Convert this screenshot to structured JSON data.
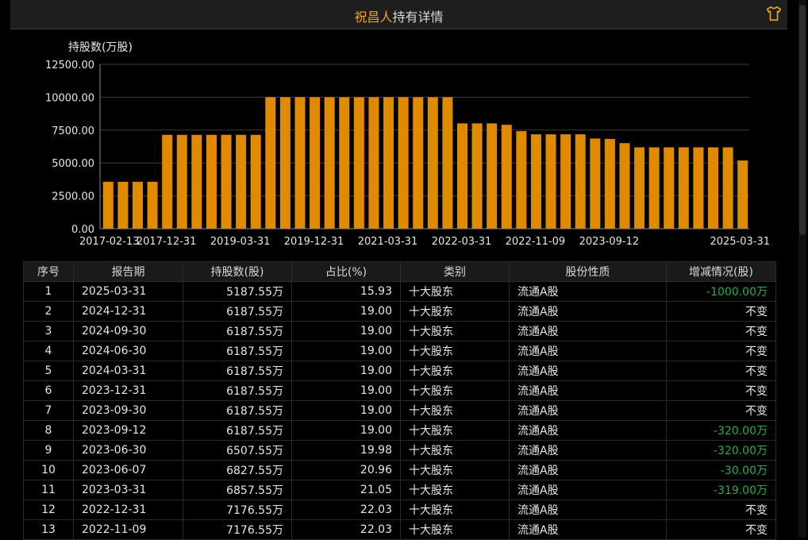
{
  "title": {
    "name": "祝昌人",
    "rest": "持有详情"
  },
  "chart_data": {
    "type": "bar",
    "ylabel": "持股数(万股)",
    "ylim": [
      0,
      12500
    ],
    "yticks": [
      "12500.00",
      "10000.00",
      "7500.00",
      "5000.00",
      "2500.00",
      "0.00"
    ],
    "xtick_labels": [
      "2017-02-13",
      "2017-12-31",
      "2019-03-31",
      "2019-12-31",
      "2021-03-31",
      "2022-03-31",
      "2022-11-09",
      "2023-09-12",
      "2025-03-31"
    ],
    "bar_color": "#e08a00",
    "values": [
      3570,
      3570,
      3570,
      3570,
      7140,
      7140,
      7140,
      7140,
      7140,
      7140,
      7140,
      10000,
      10000,
      10000,
      10000,
      10000,
      10000,
      10000,
      10000,
      10000,
      10000,
      10000,
      10000,
      10000,
      8010,
      8010,
      8010,
      7900,
      7420,
      7176.55,
      7176.55,
      7176.55,
      7176.55,
      6857.55,
      6827.55,
      6507.55,
      6187.55,
      6187.55,
      6187.55,
      6187.55,
      6187.55,
      6187.55,
      6187.55,
      5187.55
    ]
  },
  "table": {
    "headers": [
      "序号",
      "报告期",
      "持股数(股)",
      "占比(%)",
      "类别",
      "股份性质",
      "增减情况(股)"
    ],
    "rows": [
      [
        "1",
        "2025-03-31",
        "5187.55万",
        "15.93",
        "十大股东",
        "流通A股",
        "-1000.00万"
      ],
      [
        "2",
        "2024-12-31",
        "6187.55万",
        "19.00",
        "十大股东",
        "流通A股",
        "不变"
      ],
      [
        "3",
        "2024-09-30",
        "6187.55万",
        "19.00",
        "十大股东",
        "流通A股",
        "不变"
      ],
      [
        "4",
        "2024-06-30",
        "6187.55万",
        "19.00",
        "十大股东",
        "流通A股",
        "不变"
      ],
      [
        "5",
        "2024-03-31",
        "6187.55万",
        "19.00",
        "十大股东",
        "流通A股",
        "不变"
      ],
      [
        "6",
        "2023-12-31",
        "6187.55万",
        "19.00",
        "十大股东",
        "流通A股",
        "不变"
      ],
      [
        "7",
        "2023-09-30",
        "6187.55万",
        "19.00",
        "十大股东",
        "流通A股",
        "不变"
      ],
      [
        "8",
        "2023-09-12",
        "6187.55万",
        "19.00",
        "十大股东",
        "流通A股",
        "-320.00万"
      ],
      [
        "9",
        "2023-06-30",
        "6507.55万",
        "19.98",
        "十大股东",
        "流通A股",
        "-320.00万"
      ],
      [
        "10",
        "2023-06-07",
        "6827.55万",
        "20.96",
        "十大股东",
        "流通A股",
        "-30.00万"
      ],
      [
        "11",
        "2023-03-31",
        "6857.55万",
        "21.05",
        "十大股东",
        "流通A股",
        "-319.00万"
      ],
      [
        "12",
        "2022-12-31",
        "7176.55万",
        "22.03",
        "十大股东",
        "流通A股",
        "不变"
      ],
      [
        "13",
        "2022-11-09",
        "7176.55万",
        "22.03",
        "十大股东",
        "流通A股",
        "不变"
      ]
    ]
  },
  "colors": {
    "accent": "#f0a020",
    "bar": "#e08a00",
    "decrease": "#22b14c"
  }
}
